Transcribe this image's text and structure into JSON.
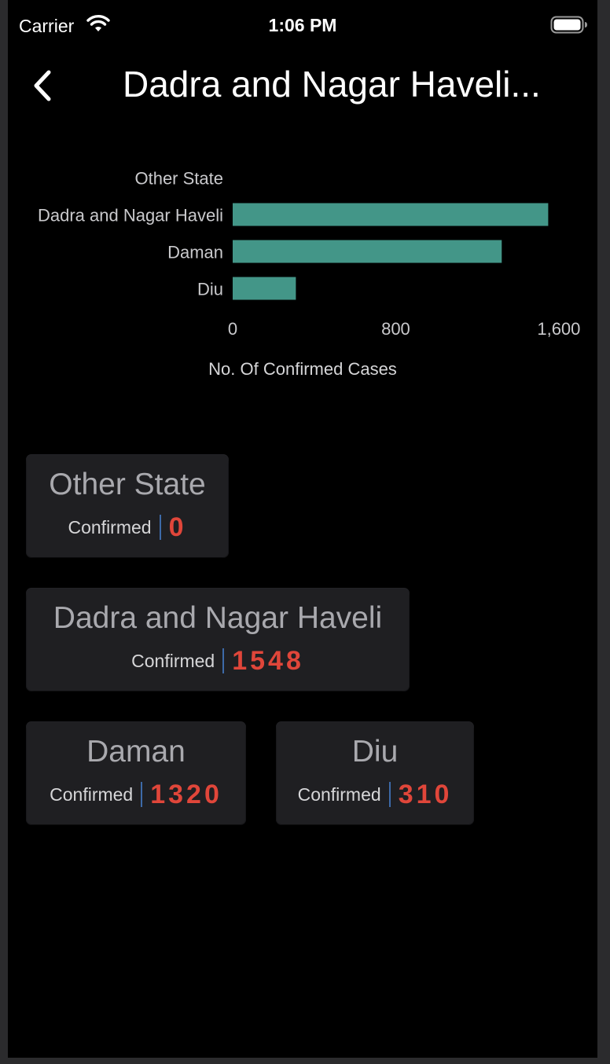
{
  "status_bar": {
    "carrier": "Carrier",
    "time": "1:06 PM"
  },
  "nav": {
    "title": "Dadra and Nagar Haveli..."
  },
  "colors": {
    "bar": "#439688",
    "value": "#e0463a",
    "separator": "#3d6aa8",
    "card_bg": "#1f1f22"
  },
  "chart_data": {
    "type": "bar",
    "orientation": "horizontal",
    "categories": [
      "Other State",
      "Dadra and Nagar Haveli",
      "Daman",
      "Diu"
    ],
    "values": [
      0,
      1548,
      1320,
      310
    ],
    "xlabel": "No. Of Confirmed Cases",
    "ylabel": "",
    "xlim": [
      0,
      1720
    ],
    "xticks": [
      0,
      800,
      1600
    ],
    "xtick_labels": [
      "0",
      "800",
      "1,600"
    ],
    "grid": false
  },
  "cards": [
    {
      "name": "Other State",
      "label": "Confirmed",
      "value": "0"
    },
    {
      "name": "Dadra and Nagar Haveli",
      "label": "Confirmed",
      "value": "1548"
    },
    {
      "name": "Daman",
      "label": "Confirmed",
      "value": "1320"
    },
    {
      "name": "Diu",
      "label": "Confirmed",
      "value": "310"
    }
  ]
}
